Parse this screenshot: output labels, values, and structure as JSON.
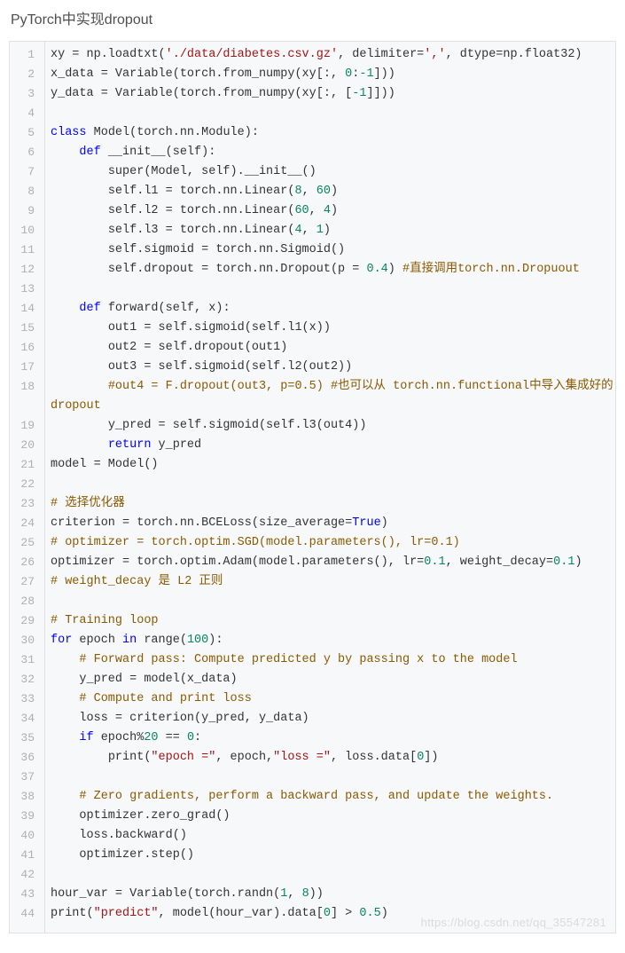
{
  "heading": "PyTorch中实现dropout",
  "watermark": "https://blog.csdn.net/qq_35547281",
  "code_lines": [
    {
      "n": 1,
      "tokens": [
        [
          "",
          "xy = np.loadtxt("
        ],
        [
          "str",
          "'./data/diabetes.csv.gz'"
        ],
        [
          "",
          ", delimiter="
        ],
        [
          "str",
          "','"
        ],
        [
          "",
          ", dtype=np.float32)"
        ]
      ]
    },
    {
      "n": 2,
      "tokens": [
        [
          "",
          "x_data = Variable(torch.from_numpy(xy[:, "
        ],
        [
          "num",
          "0"
        ],
        [
          "",
          ":"
        ],
        [
          "num",
          "-1"
        ],
        [
          "",
          "]))"
        ]
      ]
    },
    {
      "n": 3,
      "tokens": [
        [
          "",
          "y_data = Variable(torch.from_numpy(xy[:, ["
        ],
        [
          "num",
          "-1"
        ],
        [
          "",
          "]]))"
        ]
      ]
    },
    {
      "n": 4,
      "tokens": [
        [
          "",
          ""
        ]
      ]
    },
    {
      "n": 5,
      "tokens": [
        [
          "kw",
          "class"
        ],
        [
          "",
          " Model(torch.nn.Module):"
        ]
      ]
    },
    {
      "n": 6,
      "tokens": [
        [
          "",
          "    "
        ],
        [
          "kw",
          "def"
        ],
        [
          "",
          " __init__(self):"
        ]
      ]
    },
    {
      "n": 7,
      "tokens": [
        [
          "",
          "        super(Model, self).__init__()"
        ]
      ]
    },
    {
      "n": 8,
      "tokens": [
        [
          "",
          "        self.l1 = torch.nn.Linear("
        ],
        [
          "num",
          "8"
        ],
        [
          "",
          ", "
        ],
        [
          "num",
          "60"
        ],
        [
          "",
          ")"
        ]
      ]
    },
    {
      "n": 9,
      "tokens": [
        [
          "",
          "        self.l2 = torch.nn.Linear("
        ],
        [
          "num",
          "60"
        ],
        [
          "",
          ", "
        ],
        [
          "num",
          "4"
        ],
        [
          "",
          ")"
        ]
      ]
    },
    {
      "n": 10,
      "tokens": [
        [
          "",
          "        self.l3 = torch.nn.Linear("
        ],
        [
          "num",
          "4"
        ],
        [
          "",
          ", "
        ],
        [
          "num",
          "1"
        ],
        [
          "",
          ")"
        ]
      ]
    },
    {
      "n": 11,
      "tokens": [
        [
          "",
          "        self.sigmoid = torch.nn.Sigmoid()"
        ]
      ]
    },
    {
      "n": 12,
      "tokens": [
        [
          "",
          "        self.dropout = torch.nn.Dropout(p = "
        ],
        [
          "num",
          "0.4"
        ],
        [
          "",
          ") "
        ],
        [
          "cmt",
          "#直接调用torch.nn.Dropuout"
        ]
      ]
    },
    {
      "n": 13,
      "tokens": [
        [
          "",
          ""
        ]
      ]
    },
    {
      "n": 14,
      "tokens": [
        [
          "",
          "    "
        ],
        [
          "kw",
          "def"
        ],
        [
          "",
          " forward(self, x):"
        ]
      ]
    },
    {
      "n": 15,
      "tokens": [
        [
          "",
          "        out1 = self.sigmoid(self.l1(x))"
        ]
      ]
    },
    {
      "n": 16,
      "tokens": [
        [
          "",
          "        out2 = self.dropout(out1)"
        ]
      ]
    },
    {
      "n": 17,
      "tokens": [
        [
          "",
          "        out3 = self.sigmoid(self.l2(out2))"
        ]
      ]
    },
    {
      "n": 18,
      "tokens": [
        [
          "",
          "        "
        ],
        [
          "cmt",
          "#out4 = F.dropout(out3, p=0.5) #也可以从 torch.nn.functional中导入集成好的dropout"
        ]
      ]
    },
    {
      "n": 19,
      "tokens": [
        [
          "",
          "        y_pred = self.sigmoid(self.l3(out4))"
        ]
      ]
    },
    {
      "n": 20,
      "tokens": [
        [
          "",
          "        "
        ],
        [
          "kw",
          "return"
        ],
        [
          "",
          " y_pred"
        ]
      ]
    },
    {
      "n": 21,
      "tokens": [
        [
          "",
          "model = Model()"
        ]
      ]
    },
    {
      "n": 22,
      "tokens": [
        [
          "",
          ""
        ]
      ]
    },
    {
      "n": 23,
      "tokens": [
        [
          "cmt",
          "# 选择优化器"
        ]
      ]
    },
    {
      "n": 24,
      "tokens": [
        [
          "",
          "criterion = torch.nn.BCELoss(size_average="
        ],
        [
          "bool",
          "True"
        ],
        [
          "",
          ")"
        ]
      ]
    },
    {
      "n": 25,
      "tokens": [
        [
          "cmt",
          "# optimizer = torch.optim.SGD(model.parameters(), lr=0.1)"
        ]
      ]
    },
    {
      "n": 26,
      "tokens": [
        [
          "",
          "optimizer = torch.optim.Adam(model.parameters(), lr="
        ],
        [
          "num",
          "0.1"
        ],
        [
          "",
          ", weight_decay="
        ],
        [
          "num",
          "0.1"
        ],
        [
          "",
          ")"
        ]
      ]
    },
    {
      "n": 27,
      "tokens": [
        [
          "cmt",
          "# weight_decay 是 L2 正则"
        ]
      ]
    },
    {
      "n": 28,
      "tokens": [
        [
          "",
          ""
        ]
      ]
    },
    {
      "n": 29,
      "tokens": [
        [
          "cmt",
          "# Training loop"
        ]
      ]
    },
    {
      "n": 30,
      "tokens": [
        [
          "kw",
          "for"
        ],
        [
          "",
          " epoch "
        ],
        [
          "kw",
          "in"
        ],
        [
          "",
          " range("
        ],
        [
          "num",
          "100"
        ],
        [
          "",
          "):"
        ]
      ]
    },
    {
      "n": 31,
      "tokens": [
        [
          "",
          "    "
        ],
        [
          "cmt",
          "# Forward pass: Compute predicted y by passing x to the model"
        ]
      ]
    },
    {
      "n": 32,
      "tokens": [
        [
          "",
          "    y_pred = model(x_data)"
        ]
      ]
    },
    {
      "n": 33,
      "tokens": [
        [
          "",
          "    "
        ],
        [
          "cmt",
          "# Compute and print loss"
        ]
      ]
    },
    {
      "n": 34,
      "tokens": [
        [
          "",
          "    loss = criterion(y_pred, y_data)"
        ]
      ]
    },
    {
      "n": 35,
      "tokens": [
        [
          "",
          "    "
        ],
        [
          "kw",
          "if"
        ],
        [
          "",
          " epoch%"
        ],
        [
          "num",
          "20"
        ],
        [
          "",
          " == "
        ],
        [
          "num",
          "0"
        ],
        [
          "",
          ":"
        ]
      ]
    },
    {
      "n": 36,
      "tokens": [
        [
          "",
          "        print("
        ],
        [
          "str",
          "\"epoch =\""
        ],
        [
          "",
          ", epoch,"
        ],
        [
          "str",
          "\"loss =\""
        ],
        [
          "",
          ", loss.data["
        ],
        [
          "num",
          "0"
        ],
        [
          "",
          "])"
        ]
      ]
    },
    {
      "n": 37,
      "tokens": [
        [
          "",
          ""
        ]
      ]
    },
    {
      "n": 38,
      "tokens": [
        [
          "",
          "    "
        ],
        [
          "cmt",
          "# Zero gradients, perform a backward pass, and update the weights."
        ]
      ]
    },
    {
      "n": 39,
      "tokens": [
        [
          "",
          "    optimizer.zero_grad()"
        ]
      ]
    },
    {
      "n": 40,
      "tokens": [
        [
          "",
          "    loss.backward()"
        ]
      ]
    },
    {
      "n": 41,
      "tokens": [
        [
          "",
          "    optimizer.step()"
        ]
      ]
    },
    {
      "n": 42,
      "tokens": [
        [
          "",
          ""
        ]
      ]
    },
    {
      "n": 43,
      "tokens": [
        [
          "",
          "hour_var = Variable(torch.randn("
        ],
        [
          "num",
          "1"
        ],
        [
          "",
          ", "
        ],
        [
          "num",
          "8"
        ],
        [
          "",
          "))"
        ]
      ]
    },
    {
      "n": 44,
      "tokens": [
        [
          "",
          "print("
        ],
        [
          "str",
          "\"predict\""
        ],
        [
          "",
          ", model(hour_var).data["
        ],
        [
          "num",
          "0"
        ],
        [
          "",
          "] > "
        ],
        [
          "num",
          "0.5"
        ],
        [
          "",
          ")"
        ]
      ]
    }
  ]
}
